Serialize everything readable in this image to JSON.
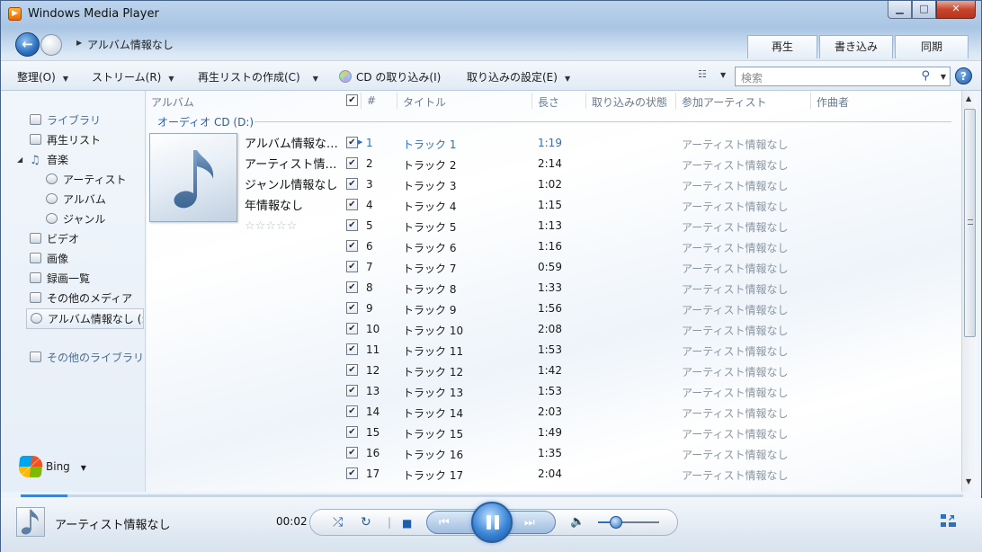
{
  "window": {
    "title": "Windows Media Player",
    "controls": {
      "minimize": "▁",
      "maximize": "□",
      "close": "✕"
    }
  },
  "nav": {
    "breadcrumb": "アルバム情報なし",
    "tabs": [
      {
        "label": "再生"
      },
      {
        "label": "書き込み"
      },
      {
        "label": "同期"
      }
    ]
  },
  "toolbar": {
    "organize": "整理(O)",
    "stream": "ストリーム(R)",
    "create_playlist": "再生リストの作成(C)",
    "rip_cd": "CD の取り込み(I)",
    "rip_settings": "取り込みの設定(E)",
    "search_placeholder": "検索",
    "help": "?"
  },
  "sidebar": {
    "items": [
      {
        "label": "ライブラリ",
        "icon": "library-icon"
      },
      {
        "label": "再生リスト",
        "icon": "playlist-icon"
      },
      {
        "label": "音楽",
        "icon": "music-note-icon"
      },
      {
        "label": "アーティスト",
        "icon": "artist-icon"
      },
      {
        "label": "アルバム",
        "icon": "album-icon"
      },
      {
        "label": "ジャンル",
        "icon": "genre-icon"
      },
      {
        "label": "ビデオ",
        "icon": "video-icon"
      },
      {
        "label": "画像",
        "icon": "picture-icon"
      },
      {
        "label": "録画一覧",
        "icon": "recorded-tv-icon"
      },
      {
        "label": "その他のメディア",
        "icon": "other-media-icon"
      },
      {
        "label": "アルバム情報なし (:",
        "icon": "cd-icon"
      }
    ],
    "other_libraries": "その他のライブラリ",
    "bing": "Bing"
  },
  "columns": {
    "album": "アルバム",
    "number": "#",
    "title": "タイトル",
    "length": "長さ",
    "rip_status": "取り込みの状態",
    "contributing_artist": "参加アーティスト",
    "composer": "作曲者"
  },
  "section_title": "オーディオ CD (D:)",
  "album": {
    "name": "アルバム情報なし...",
    "artist": "アーティスト情報...",
    "genre": "ジャンル情報なし",
    "year": "年情報なし",
    "rating": 0
  },
  "tracks": [
    {
      "num": "1",
      "title": "トラック 1",
      "length": "1:19",
      "artist": "アーティスト情報なし",
      "checked": true,
      "playing": true
    },
    {
      "num": "2",
      "title": "トラック 2",
      "length": "2:14",
      "artist": "アーティスト情報なし",
      "checked": true
    },
    {
      "num": "3",
      "title": "トラック 3",
      "length": "1:02",
      "artist": "アーティスト情報なし",
      "checked": true
    },
    {
      "num": "4",
      "title": "トラック 4",
      "length": "1:15",
      "artist": "アーティスト情報なし",
      "checked": true
    },
    {
      "num": "5",
      "title": "トラック 5",
      "length": "1:13",
      "artist": "アーティスト情報なし",
      "checked": true
    },
    {
      "num": "6",
      "title": "トラック 6",
      "length": "1:16",
      "artist": "アーティスト情報なし",
      "checked": true
    },
    {
      "num": "7",
      "title": "トラック 7",
      "length": "0:59",
      "artist": "アーティスト情報なし",
      "checked": true
    },
    {
      "num": "8",
      "title": "トラック 8",
      "length": "1:33",
      "artist": "アーティスト情報なし",
      "checked": true
    },
    {
      "num": "9",
      "title": "トラック 9",
      "length": "1:56",
      "artist": "アーティスト情報なし",
      "checked": true
    },
    {
      "num": "10",
      "title": "トラック 10",
      "length": "2:08",
      "artist": "アーティスト情報なし",
      "checked": true
    },
    {
      "num": "11",
      "title": "トラック 11",
      "length": "1:53",
      "artist": "アーティスト情報なし",
      "checked": true
    },
    {
      "num": "12",
      "title": "トラック 12",
      "length": "1:42",
      "artist": "アーティスト情報なし",
      "checked": true
    },
    {
      "num": "13",
      "title": "トラック 13",
      "length": "1:53",
      "artist": "アーティスト情報なし",
      "checked": true
    },
    {
      "num": "14",
      "title": "トラック 14",
      "length": "2:03",
      "artist": "アーティスト情報なし",
      "checked": true
    },
    {
      "num": "15",
      "title": "トラック 15",
      "length": "1:49",
      "artist": "アーティスト情報なし",
      "checked": true
    },
    {
      "num": "16",
      "title": "トラック 16",
      "length": "1:35",
      "artist": "アーティスト情報なし",
      "checked": true
    },
    {
      "num": "17",
      "title": "トラック 17",
      "length": "2:04",
      "artist": "アーティスト情報なし",
      "checked": true
    }
  ],
  "player": {
    "now_playing_artist": "アーティスト情報なし",
    "elapsed": "00:02",
    "volume": 0.3,
    "progress": 0.05
  }
}
